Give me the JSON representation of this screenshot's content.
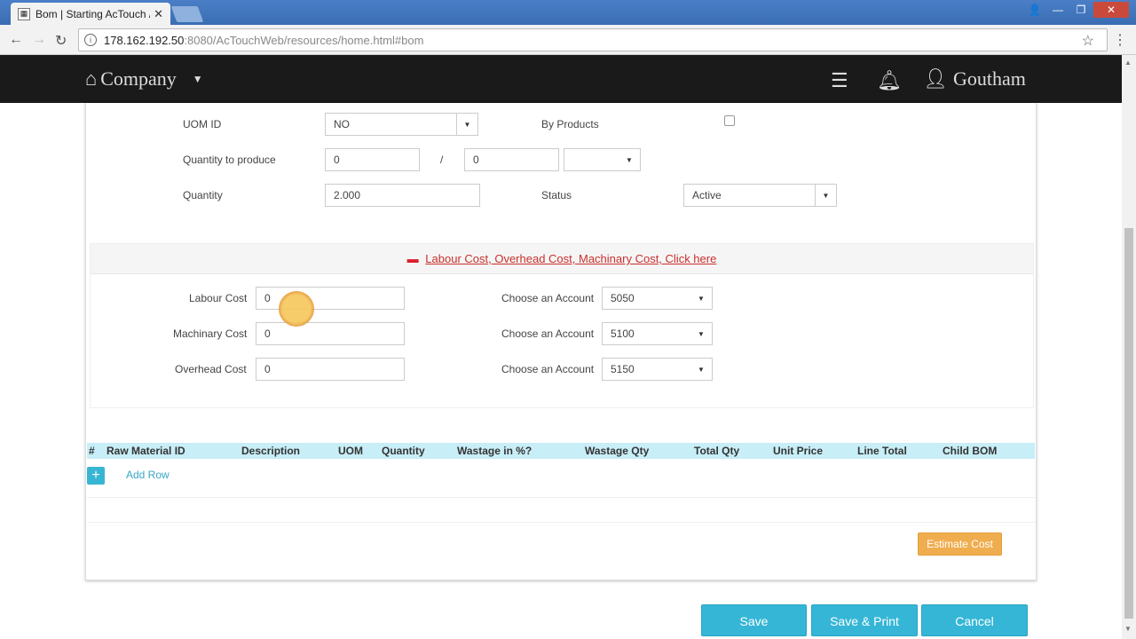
{
  "browser": {
    "tab_title": "Bom | Starting AcTouch /",
    "url_host": "178.162.192.50",
    "url_port": ":8080",
    "url_path": "/AcTouchWeb/resources/home.html#bom"
  },
  "header": {
    "brand": "Company",
    "user": "Goutham"
  },
  "form": {
    "uom_id_label": "UOM ID",
    "uom_id_value": "NO",
    "by_products_label": "By Products",
    "qty_produce_label": "Quantity to produce",
    "qty_produce_value": "0",
    "qty_produce_sep": "/",
    "qty_produce_value2": "0",
    "qty_produce_unit": "",
    "quantity_label": "Quantity",
    "quantity_value": "2.000",
    "status_label": "Status",
    "status_value": "Active"
  },
  "costs": {
    "toggle_text": "Labour Cost, Overhead Cost, Machinary Cost, Click here",
    "labour_label": "Labour Cost",
    "labour_value": "0",
    "machinary_label": "Machinary Cost",
    "machinary_value": "0",
    "overhead_label": "Overhead Cost",
    "overhead_value": "0",
    "account_label": "Choose an Account",
    "labour_account": "5050",
    "machinary_account": "5100",
    "overhead_account": "5150"
  },
  "table": {
    "columns": [
      "#",
      "Raw Material ID",
      "Description",
      "UOM",
      "Quantity",
      "Wastage in %?",
      "Wastage Qty",
      "Total Qty",
      "Unit Price",
      "Line Total",
      "Child BOM"
    ],
    "add_row_label": "Add Row"
  },
  "actions": {
    "estimate": "Estimate Cost",
    "save": "Save",
    "save_print": "Save & Print",
    "cancel": "Cancel"
  }
}
